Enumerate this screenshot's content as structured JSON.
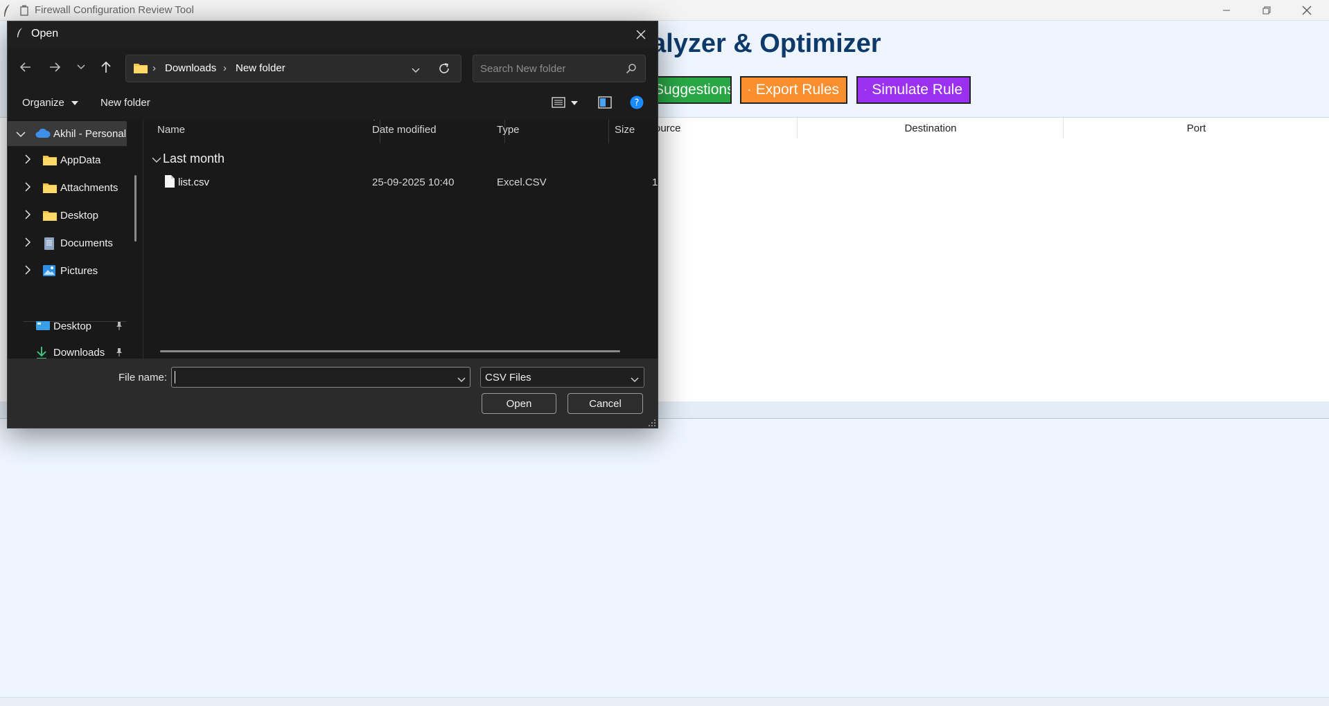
{
  "window": {
    "title": "Firewall Configuration Review Tool",
    "heading": "alyzer & Optimizer",
    "buttons": {
      "suggestions": "Suggestions",
      "export": "Export Rules",
      "simulate": "Simulate Rule"
    },
    "columns": [
      "ource",
      "Destination",
      "Port"
    ],
    "colors": {
      "suggestions": "#29a745",
      "export": "#f98f2f",
      "simulate": "#9b30f0",
      "heading": "#0d3a6b"
    }
  },
  "dialog": {
    "title": "Open",
    "breadcrumb": [
      "Downloads",
      "New folder"
    ],
    "search_placeholder": "Search New folder",
    "commands": {
      "organize": "Organize",
      "new_folder": "New folder"
    },
    "nav": [
      {
        "label": "Akhil - Personal",
        "icon": "cloud-icon"
      },
      {
        "label": "AppData",
        "icon": "folder-icon"
      },
      {
        "label": "Attachments",
        "icon": "folder-icon"
      },
      {
        "label": "Desktop",
        "icon": "folder-icon"
      },
      {
        "label": "Documents",
        "icon": "documents-icon"
      },
      {
        "label": "Pictures",
        "icon": "pictures-icon"
      },
      {
        "label": "Desktop",
        "icon": "desktop-icon"
      },
      {
        "label": "Downloads",
        "icon": "download-icon"
      }
    ],
    "headers": {
      "name": "Name",
      "date": "Date modified",
      "type": "Type",
      "size": "Size"
    },
    "group": "Last month",
    "files": [
      {
        "name": "list.csv",
        "date": "25-09-2025 10:40",
        "type": "Excel.CSV",
        "size": "1"
      }
    ],
    "filename_label": "File name:",
    "filename_value": "",
    "filetype": "CSV Files",
    "open_label": "Open",
    "cancel_label": "Cancel"
  }
}
